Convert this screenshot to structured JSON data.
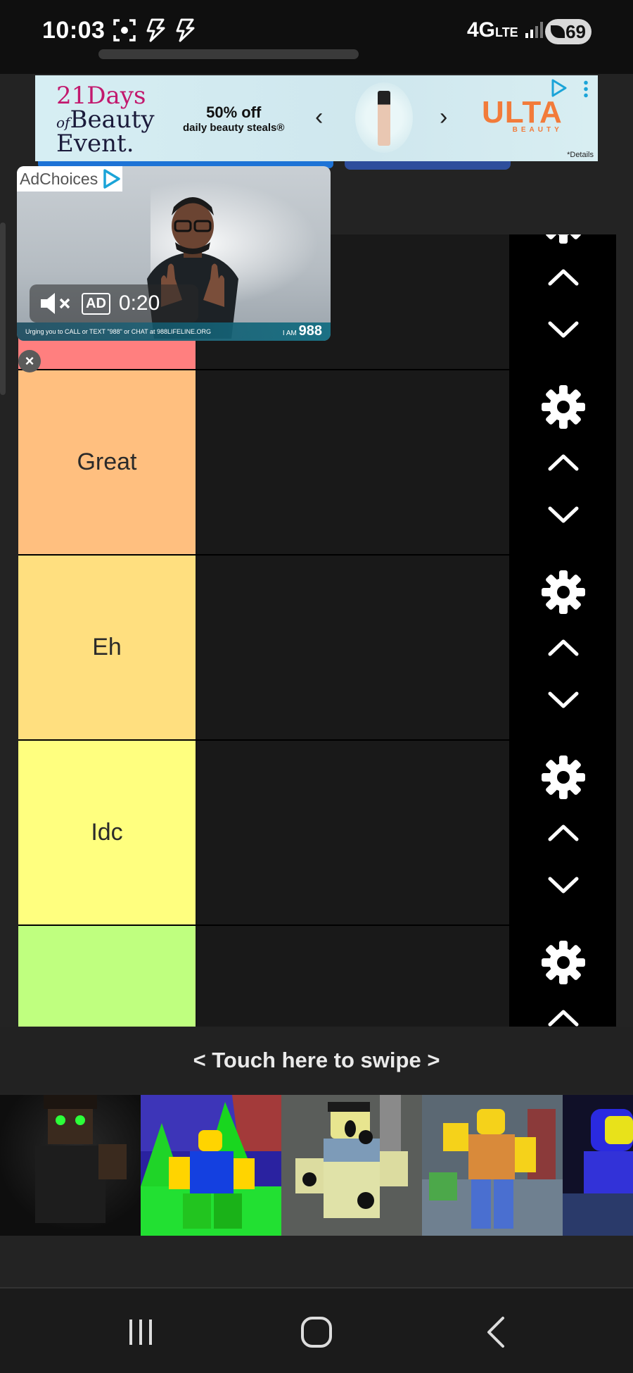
{
  "status_bar": {
    "time": "10:03",
    "network": "4G",
    "network_sub": "LTE",
    "battery": "69"
  },
  "banner_ad": {
    "logo_line1": "21Days",
    "logo_line2_of": "of",
    "logo_line2": "Beauty",
    "logo_line3": "Event.",
    "offer": "50% off",
    "offer_sub": "daily beauty steals®",
    "brand": "ULTA",
    "brand_sub": "BEAUTY",
    "details": "*Details",
    "colors": {
      "accent": "#c2186d",
      "brand": "#f27b3a"
    }
  },
  "video_ad": {
    "adchoices": "AdChoices",
    "ad_label": "AD",
    "timer": "0:20",
    "footer": "Urging you to CALL or TEXT \"988\" or CHAT at 988LIFELINE.ORG",
    "tag_prefix": "I AM",
    "tag_number": "988",
    "close": "×"
  },
  "tiers": [
    {
      "label": "",
      "color": "#ff7f7f"
    },
    {
      "label": "Great",
      "color": "#ffbf7f"
    },
    {
      "label": "Eh",
      "color": "#ffdf7f"
    },
    {
      "label": "Idc",
      "color": "#ffff7f"
    },
    {
      "label": "",
      "color": "#bfff7f"
    }
  ],
  "tier_controls": {
    "settings_icon": "gear-icon",
    "up_icon": "chevron-up-icon",
    "down_icon": "chevron-down-icon"
  },
  "swipe_area": {
    "text": "< Touch here to swipe >"
  },
  "thumbnails": [
    "roblox-character-green-eyes",
    "roblox-noob-green-trees",
    "roblox-noob-screaming-spiders",
    "roblox-noob-waving",
    "roblox-blue-character"
  ],
  "nav": {
    "recent_icon": "recent-apps-icon",
    "home_icon": "home-icon",
    "back_icon": "back-icon"
  }
}
